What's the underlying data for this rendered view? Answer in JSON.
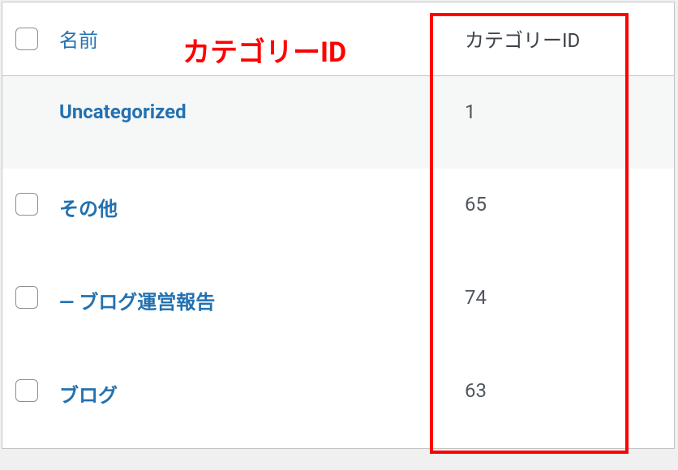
{
  "annotation": {
    "label": "カテゴリーID"
  },
  "table": {
    "headers": {
      "name": "名前",
      "category_id": "カテゴリーID"
    },
    "rows": [
      {
        "name": "Uncategorized",
        "id": "1",
        "show_checkbox": false
      },
      {
        "name": "その他",
        "id": "65",
        "show_checkbox": true
      },
      {
        "name": "— ブログ運営報告",
        "id": "74",
        "show_checkbox": true
      },
      {
        "name": "ブログ",
        "id": "63",
        "show_checkbox": true
      }
    ]
  }
}
